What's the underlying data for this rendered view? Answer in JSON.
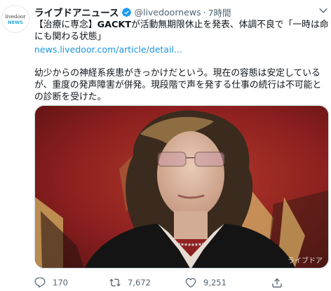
{
  "avatar": {
    "line1": "livedoor",
    "line2": "NEWS"
  },
  "tweet": {
    "name": "ライブドアニュース",
    "handle": "@livedoornews",
    "separator": "·",
    "time": "7時間",
    "text_prefix": "【治療に専念】",
    "text_bold": "GACKT",
    "text_rest": "が活動無期限休止を発表、体調不良で「一時は命にも関わる状態」",
    "link": "news.livedoor.com/article/detail...",
    "body": "幼少からの神経系疾患がきっかけだという。現在の容態は安定しているが、重度の発声障害が併発。現段階で声を発する仕事の続行は不可能との診断を受けた。"
  },
  "media": {
    "watermark": "ライブドア"
  },
  "actions": {
    "reply_count": "170",
    "retweet_count": "7,672",
    "like_count": "9,251"
  },
  "colors": {
    "accent": "#1d9bf0",
    "link": "#1b95e0",
    "muted": "#536471"
  },
  "icons": [
    "chevron-down-icon",
    "verified-badge-icon",
    "reply-icon",
    "retweet-icon",
    "like-icon",
    "share-icon"
  ]
}
